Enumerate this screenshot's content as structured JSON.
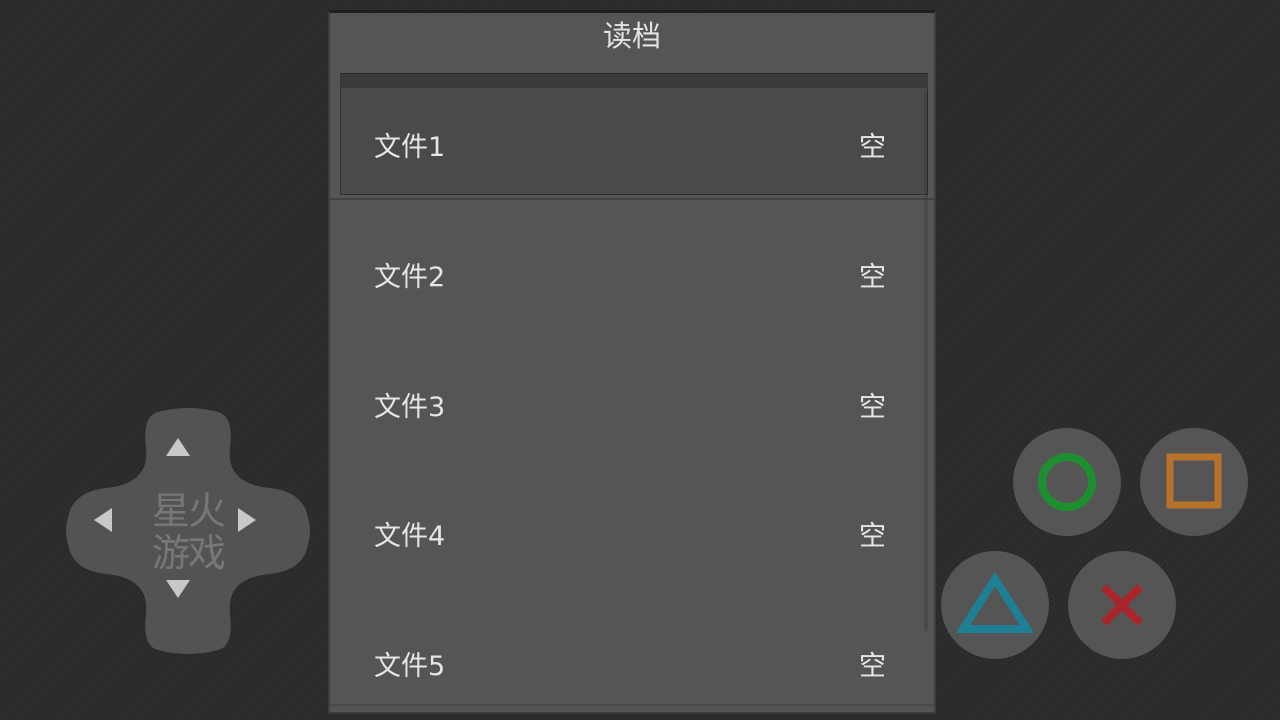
{
  "dialog": {
    "title": "读档",
    "slots": [
      {
        "name": "文件1",
        "status": "空",
        "selected": true
      },
      {
        "name": "文件2",
        "status": "空",
        "selected": false
      },
      {
        "name": "文件3",
        "status": "空",
        "selected": false
      },
      {
        "name": "文件4",
        "status": "空",
        "selected": false
      },
      {
        "name": "文件5",
        "status": "空",
        "selected": false
      }
    ]
  },
  "dpad": {
    "logo_line1": "星火",
    "logo_line2": "游戏",
    "icons": [
      "up-arrow-icon",
      "down-arrow-icon",
      "left-arrow-icon",
      "right-arrow-icon"
    ]
  },
  "face_buttons": [
    {
      "name": "circle-button",
      "icon": "circle-icon",
      "color": "#1e8f2f"
    },
    {
      "name": "square-button",
      "icon": "square-icon",
      "color": "#b8732a"
    },
    {
      "name": "triangle-button",
      "icon": "triangle-icon",
      "color": "#1e7f95"
    },
    {
      "name": "cross-button",
      "icon": "cross-icon",
      "color": "#a8262a"
    }
  ],
  "colors": {
    "background": "#2b2b2b",
    "dialog": "#555555",
    "selected_row": "#4a4a4a",
    "text": "#e6e6e6"
  }
}
